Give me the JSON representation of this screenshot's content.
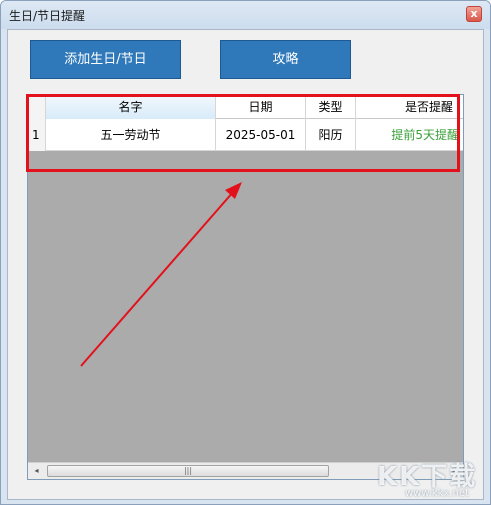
{
  "window": {
    "title": "生日/节日提醒",
    "close_label": "x"
  },
  "toolbar": {
    "add_label": "添加生日/节日",
    "guide_label": "攻略"
  },
  "table": {
    "columns": [
      "名字",
      "日期",
      "类型",
      "是否提醒"
    ],
    "rows": [
      {
        "index": "1",
        "name": "五一劳动节",
        "date": "2025-05-01",
        "type": "阳历",
        "remind": "提前5天提醒"
      }
    ]
  },
  "scrollbar": {
    "left_arrow": "◂",
    "right_arrow": "▸",
    "thumb_grip": "|||"
  },
  "colors": {
    "highlight": "#e3111b",
    "button": "#2f78b9",
    "remind_text": "#3aa13a"
  },
  "watermark": {
    "logo": "KK下载",
    "url": "www.kkx.net"
  }
}
